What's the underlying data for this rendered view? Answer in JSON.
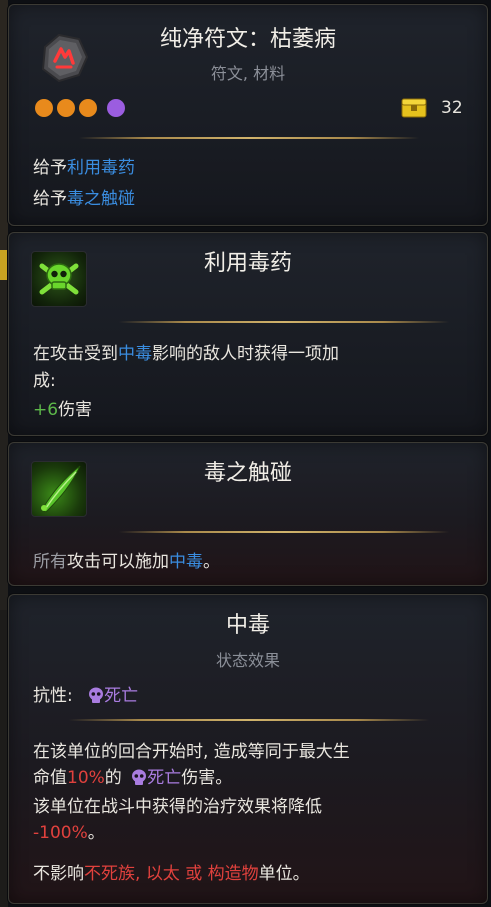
{
  "item": {
    "title": "纯净符文：枯萎病",
    "subtitle": "符文, 材料",
    "gold": "32",
    "lines": [
      {
        "prefix": "给予",
        "link": "利用毒药"
      },
      {
        "prefix": "给予",
        "link": "毒之触碰"
      }
    ],
    "slots": [
      {
        "color": "#e88a1c"
      },
      {
        "color": "#e88a1c"
      },
      {
        "color": "#e88a1c"
      },
      {
        "color": "#9b5de0"
      }
    ],
    "icons": {
      "rune": "blight-rune-icon",
      "gold": "gold-chest-icon"
    }
  },
  "exploit": {
    "title": "利用毒药",
    "desc_a": "在攻击受到",
    "desc_link": "中毒",
    "desc_b": "影响的敌人时获得一项加",
    "desc_c": "成:",
    "bonus_value": "+6",
    "bonus_label": "伤害",
    "icon": "poison-skull-icon"
  },
  "touch": {
    "title": "毒之触碰",
    "desc_a": "所有",
    "desc_b": "攻击可以施加",
    "desc_link": "中毒",
    "desc_end": "。",
    "icon": "poison-blade-icon"
  },
  "poison": {
    "title": "中毒",
    "subtitle": "状态效果",
    "resist_label": "抗性:",
    "resist_value": "死亡",
    "desc1_a": "在该单位的回合开始时, 造成等同于最大生",
    "desc1_b": "命值",
    "desc1_pct": "10%",
    "desc1_c": "的",
    "desc1_death": "死亡",
    "desc1_d": "伤害。",
    "desc2_a": "该单位在战斗中获得的治疗效果将降低",
    "desc2_pct": "-100%",
    "desc2_end": "。",
    "immune_a": "不影响",
    "immune_1": "不死族,",
    "immune_2": "以太",
    "immune_or": "或",
    "immune_3": "构造物",
    "immune_b": "单位。",
    "icon": "death-skull-icon"
  },
  "colors": {
    "link_blue": "#3a8de0",
    "bonus_green": "#5db84a",
    "warn_red": "#e0413d",
    "death_purple": "#a97ce0",
    "divider_gold": "#c9aa65"
  }
}
